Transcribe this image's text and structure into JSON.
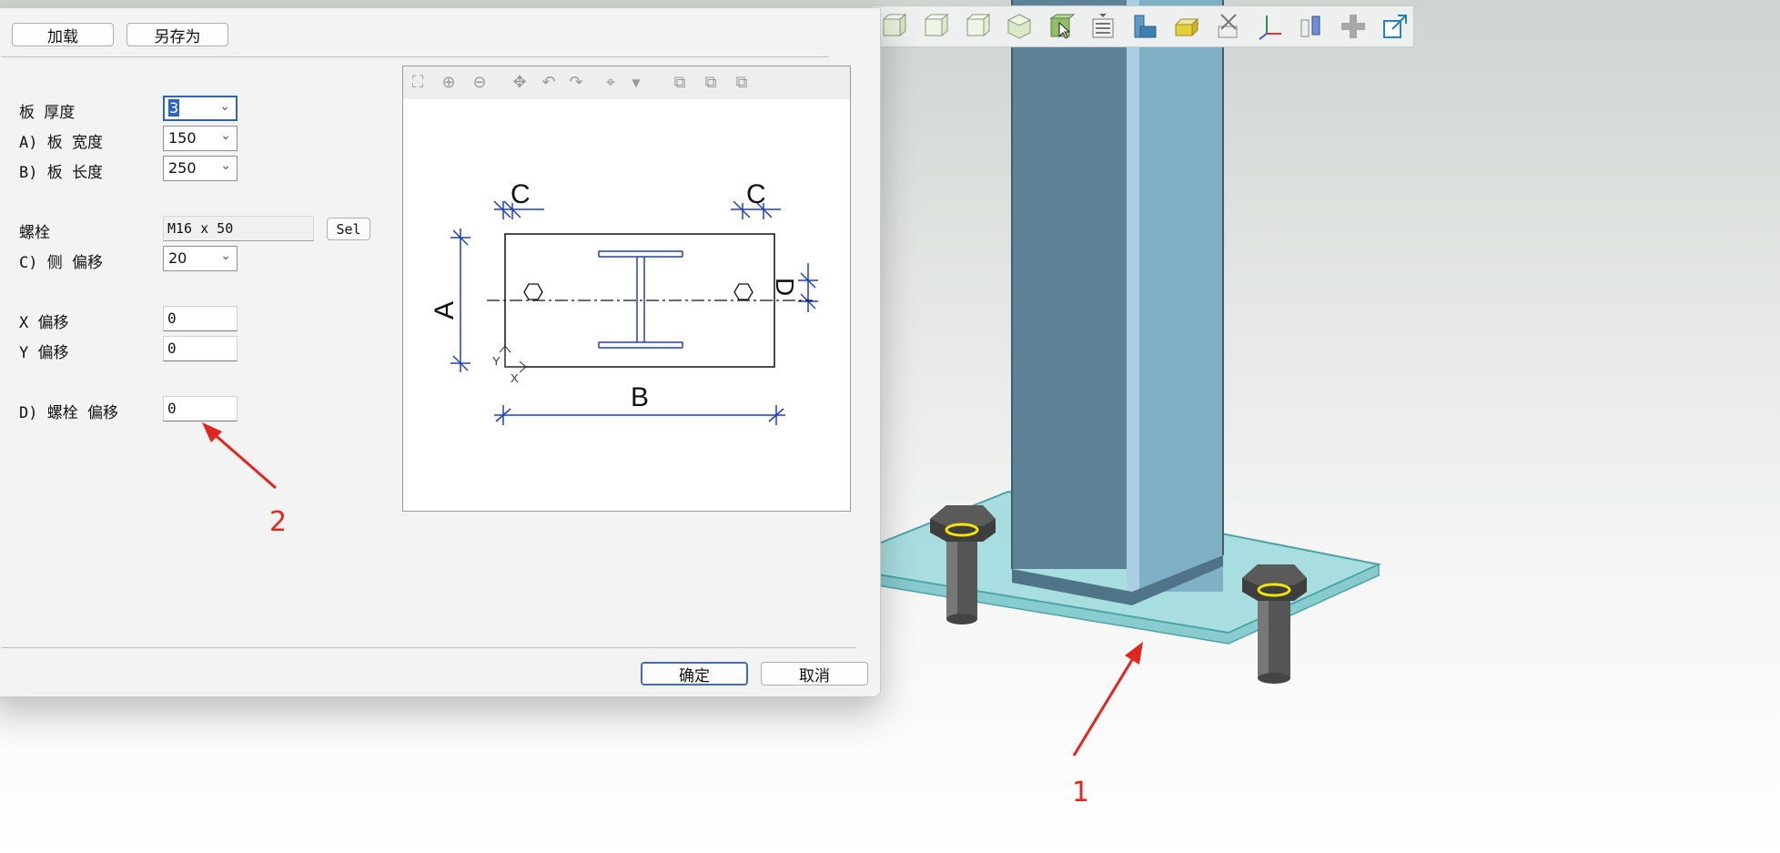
{
  "toolbar": {
    "icons": [
      "box-top-icon",
      "box-front-icon",
      "box-side-icon",
      "box-iso-icon",
      "select-green-icon",
      "list-icon",
      "shape-blue-icon",
      "shape-yellow-icon",
      "cut-icon",
      "axes-icon",
      "pair-icon",
      "cross-icon",
      "export-icon"
    ]
  },
  "dialog": {
    "load_label": "加载",
    "save_as_label": "另存为",
    "fields": {
      "plate_thickness": {
        "label": "板 厚度",
        "value": "3"
      },
      "plate_width": {
        "label": "A) 板 宽度",
        "value": "150"
      },
      "plate_length": {
        "label": "B) 板 长度",
        "value": "250"
      },
      "bolt": {
        "label": "螺栓",
        "value": "M16 x 50",
        "sel_label": "Sel"
      },
      "side_offset": {
        "label": "C) 侧 偏移",
        "value": "20"
      },
      "x_offset": {
        "label": "X 偏移",
        "value": "0"
      },
      "y_offset": {
        "label": "Y 偏移",
        "value": "0"
      },
      "bolt_offset": {
        "label": "D) 螺栓 偏移",
        "value": "0"
      }
    },
    "ok_label": "确定",
    "cancel_label": "取消"
  },
  "diagram": {
    "labels": {
      "c_left": "C",
      "c_right": "C",
      "a": "A",
      "b": "B",
      "d": "D",
      "y": "Y",
      "x": "X"
    }
  },
  "annotations": {
    "n1": "1",
    "n2": "2",
    "color": "#e0261f"
  },
  "colors": {
    "dim_blue": "#1f3fbf",
    "plate_teal": "#7fd3d6",
    "column_blue": "#6f9cb4"
  }
}
